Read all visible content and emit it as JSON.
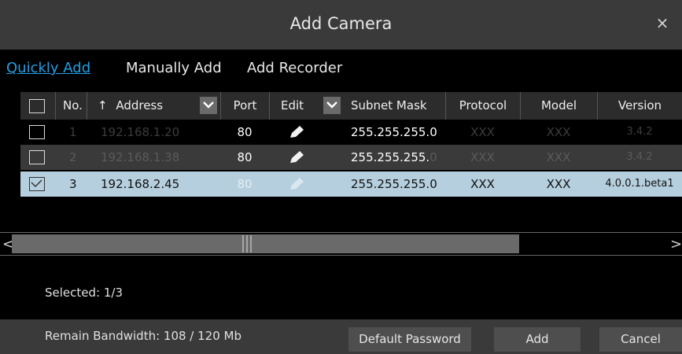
{
  "dialog": {
    "title": "Add Camera",
    "close_glyph": "×"
  },
  "tabs": [
    {
      "label": "Quickly Add",
      "active": true
    },
    {
      "label": "Manually Add",
      "active": false
    },
    {
      "label": "Add Recorder",
      "active": false
    }
  ],
  "table": {
    "headers": {
      "no": "No.",
      "sort_glyph": "↑",
      "address": "Address",
      "port": "Port",
      "edit": "Edit",
      "subnet": "Subnet Mask",
      "protocol": "Protocol",
      "model": "Model",
      "version": "Version"
    },
    "rows": [
      {
        "no": "1",
        "address": "192.168.1.20",
        "port": "80",
        "subnet": "255.255.255.0",
        "protocol": "XXX",
        "model": "XXX",
        "version": "3.4.2",
        "checked": false
      },
      {
        "no": "2",
        "address": "192.168.1.38",
        "port": "80",
        "subnet_a": "255.255.255.",
        "subnet_b": "0",
        "protocol": "XXX",
        "model": "XXX",
        "version": "3.4.2",
        "checked": false
      },
      {
        "no": "3",
        "address": "192.168.2.45",
        "port": "80",
        "subnet": "255.255.255.0",
        "protocol": "XXX",
        "model": "XXX",
        "version": "4.0.0.1.beta1",
        "checked": true
      }
    ]
  },
  "scrollbar": {
    "left_glyph": "<",
    "right_glyph": ">"
  },
  "status": {
    "selected": "Selected: 1/3"
  },
  "footer": {
    "bandwidth": "Remain Bandwidth: 108 / 120 Mb",
    "default_password_label": "Default Password",
    "add_label": "Add",
    "cancel_label": "Cancel"
  },
  "colors": {
    "accent": "#1ea0e6",
    "selected_row": "#b6cfde",
    "panel": "#3a3a3a"
  },
  "icons": {
    "edit": "pencil-icon",
    "checkbox_checked": "checkmark-icon",
    "dropdown": "chevron-down-icon"
  }
}
